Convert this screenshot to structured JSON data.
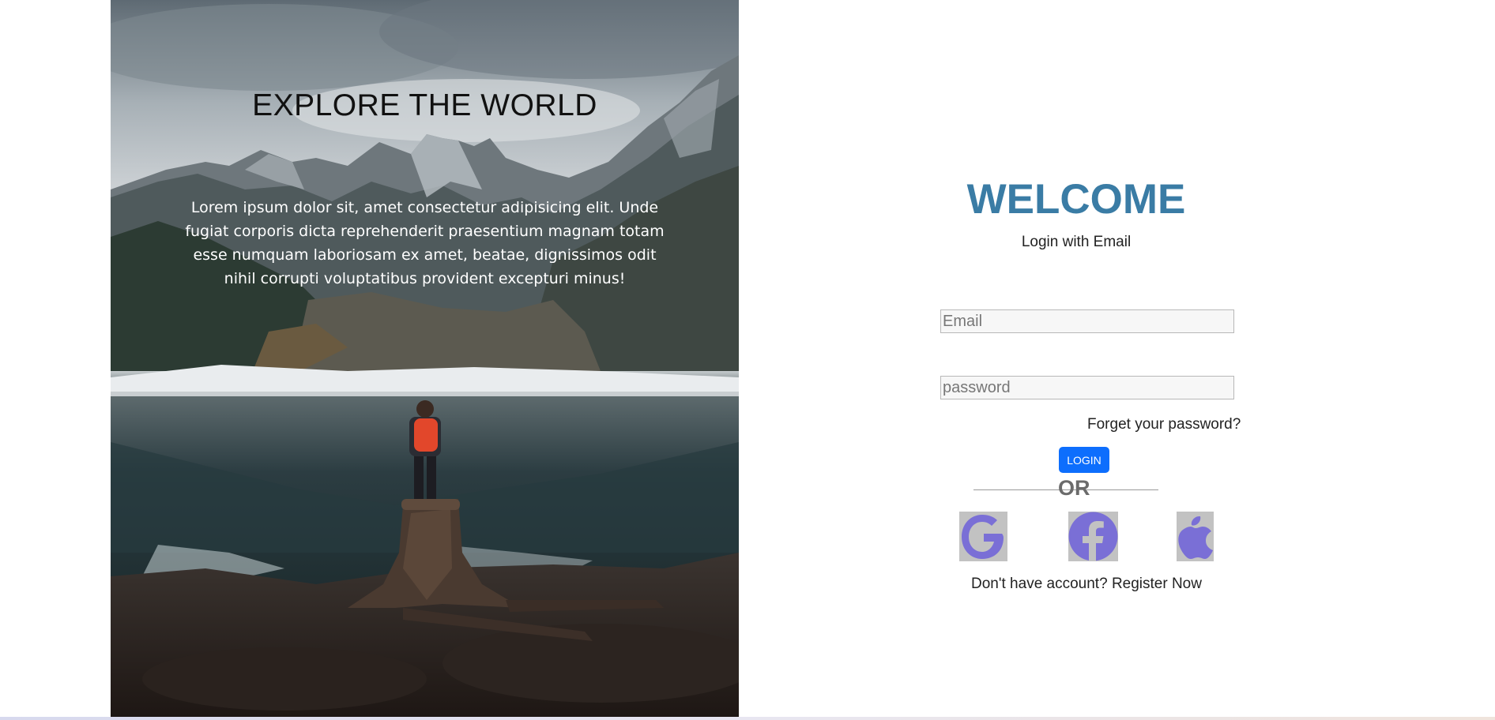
{
  "hero": {
    "title": "EXPLORE THE WORLD",
    "text": "Lorem ipsum dolor sit, amet consectetur adipisicing elit. Unde fugiat corporis dicta reprehenderit praesentium magnam totam esse numquam laboriosam ex amet, beatae, dignissimos odit nihil corrupti voluptatibus provident excepturi minus!"
  },
  "login": {
    "welcome": "WELCOME",
    "subtitle": "Login with Email",
    "email_placeholder": "Email",
    "password_placeholder": "password",
    "forgot": "Forget your password?",
    "button": "LOGIN",
    "or": "OR",
    "register_prefix": "Don't have account?",
    "register_link": "Register Now"
  },
  "social": {
    "icons": [
      "google-icon",
      "facebook-icon",
      "apple-icon"
    ],
    "icon_color": "#7a6fd6",
    "tile_color": "#c2c2c2"
  },
  "colors": {
    "welcome": "#3a7ca5",
    "button": "#0d6efd"
  }
}
